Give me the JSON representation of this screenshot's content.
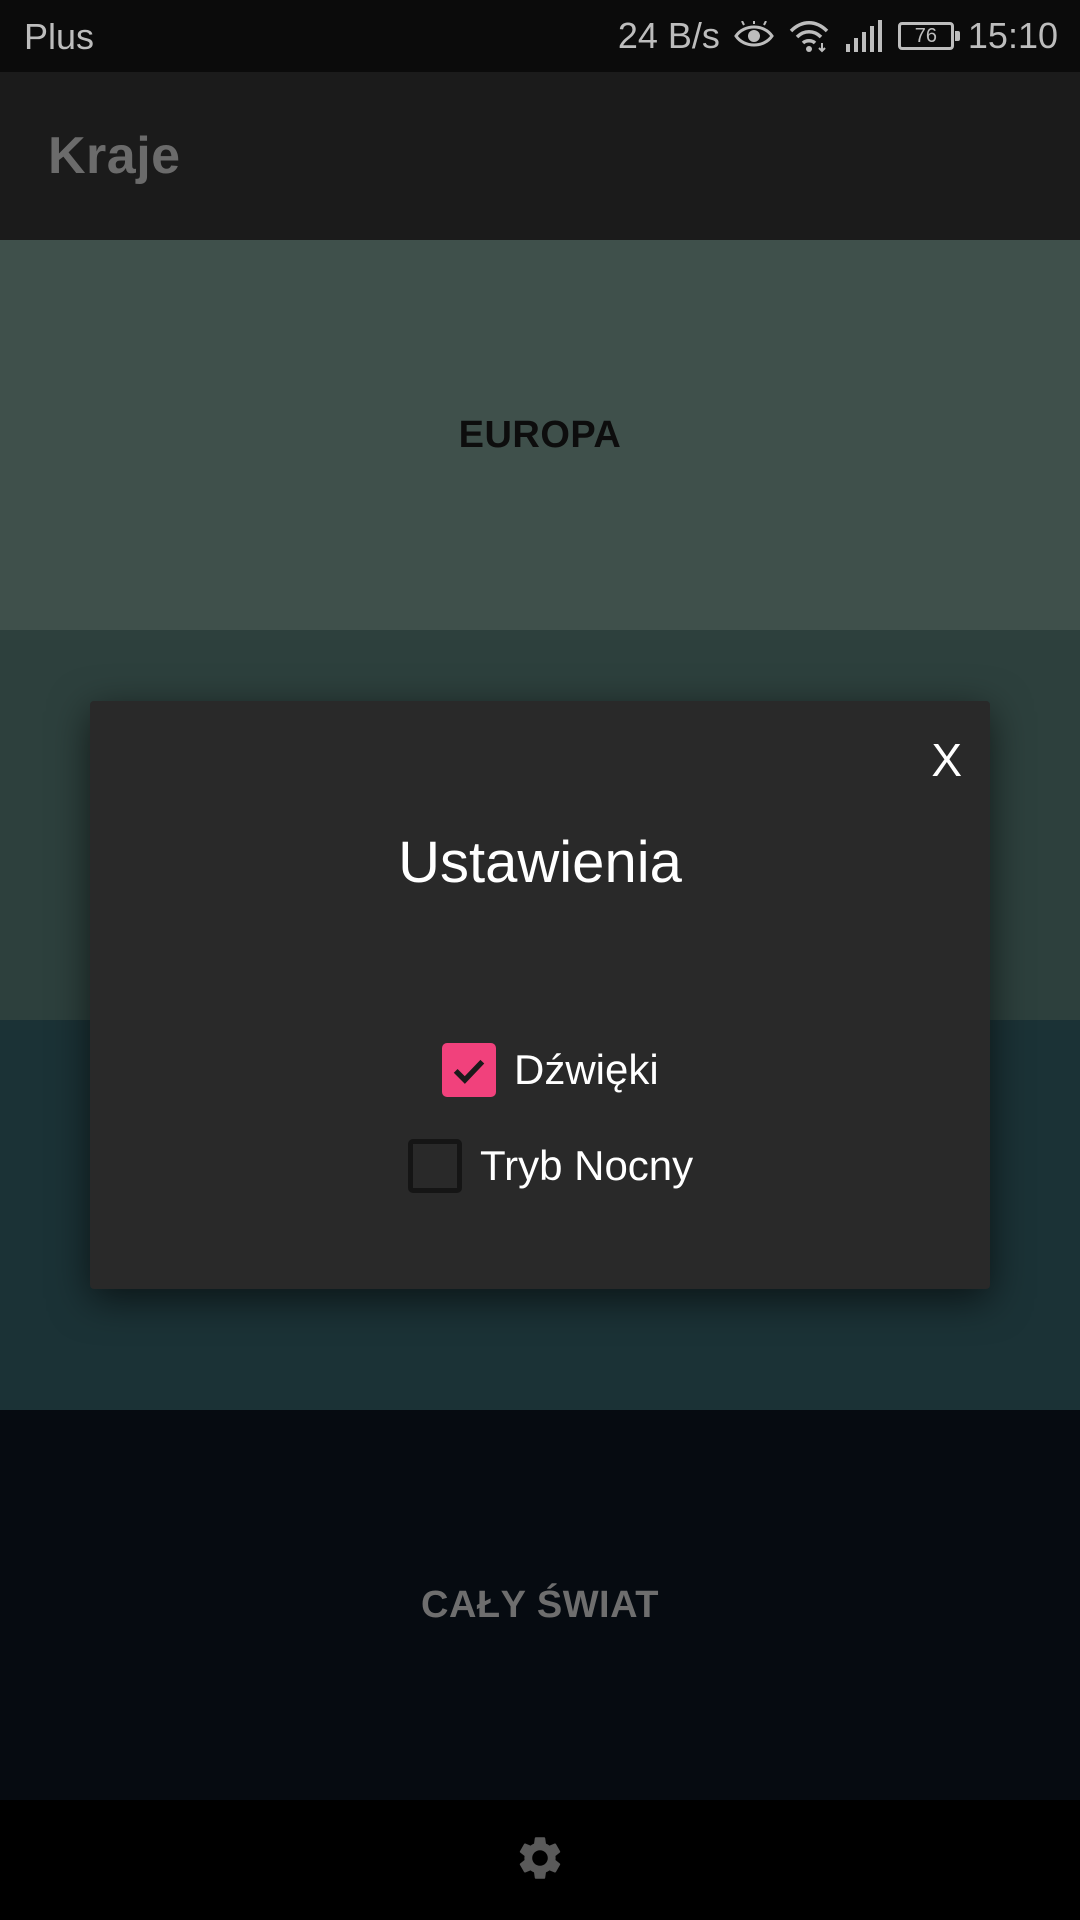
{
  "status_bar": {
    "carrier": "Plus",
    "net_speed": "24 B/s",
    "battery": "76",
    "time": "15:10",
    "icons": [
      "eye-icon",
      "wifi-icon",
      "signal-icon",
      "battery-icon"
    ]
  },
  "app_bar": {
    "title": "Kraje"
  },
  "tiles": [
    {
      "label": "EUROPA",
      "color": "#3f504b"
    },
    {
      "label": "",
      "color": "#2d403d"
    },
    {
      "label": "",
      "color": "#1b3236"
    },
    {
      "label": "CAŁY ŚWIAT",
      "color": "#060b11"
    }
  ],
  "dialog": {
    "close_label": "X",
    "title": "Ustawienia",
    "options": [
      {
        "label": "Dźwięki",
        "checked": true
      },
      {
        "label": "Tryb Nocny",
        "checked": false
      }
    ]
  },
  "bottom_bar": {
    "settings_icon": "gear-icon"
  },
  "colors": {
    "accent": "#f1417c",
    "dialog_bg": "#292929",
    "app_bar_bg": "#1b1b1b"
  }
}
